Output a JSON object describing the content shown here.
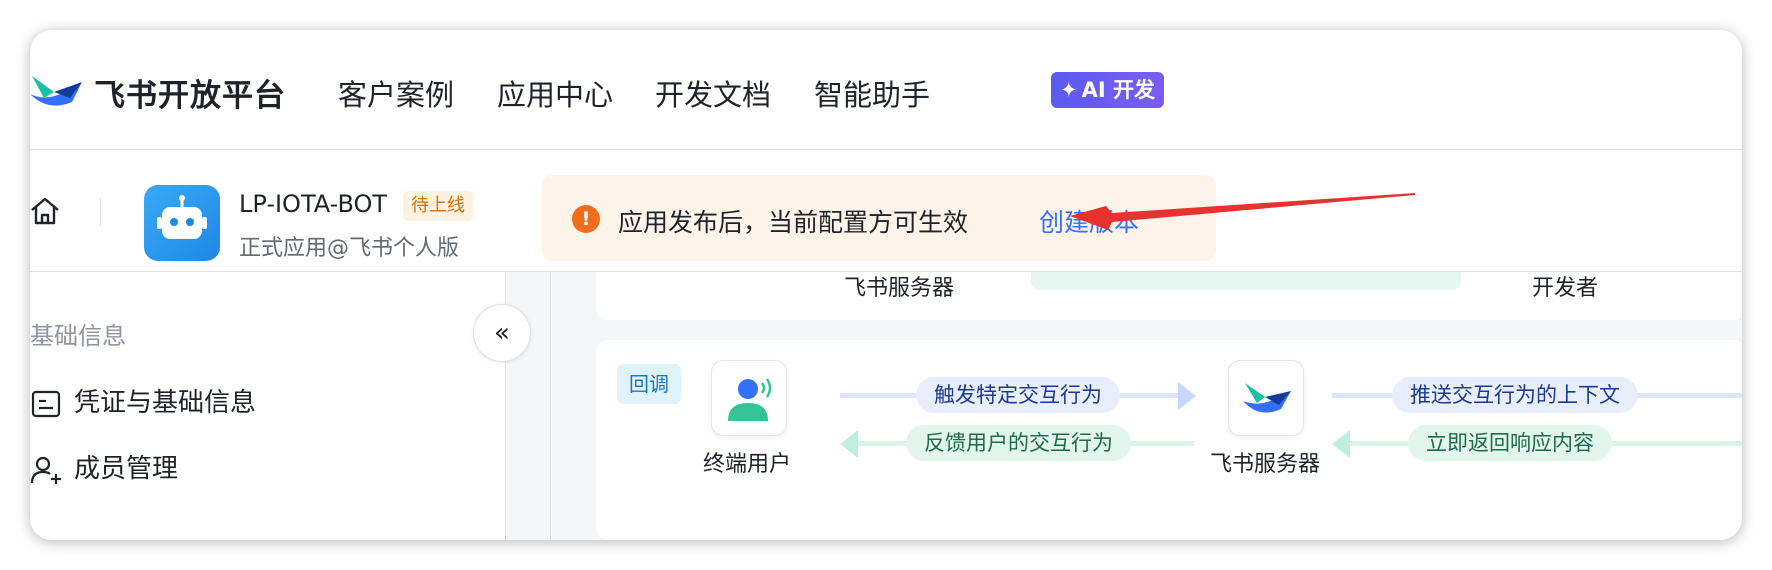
{
  "topnav": {
    "brand": "飞书开放平台",
    "items": [
      "客户案例",
      "应用中心",
      "开发文档",
      "智能助手"
    ],
    "ai_badge": "AI 开发"
  },
  "appbar": {
    "app_name": "LP-IOTA-BOT",
    "status_badge": "待上线",
    "subtitle": "正式应用@飞书个人版",
    "notice_text": "应用发布后，当前配置方可生效",
    "notice_link": "创建版本"
  },
  "sidebar": {
    "group": "基础信息",
    "items": [
      "凭证与基础信息",
      "成员管理"
    ],
    "collapse_label": "«"
  },
  "upper_card": {
    "left_label": "飞书服务器",
    "right_label": "开发者"
  },
  "flow": {
    "tag": "回调",
    "end_user_label": "终端用户",
    "server_label": "飞书服务器",
    "pill_trigger": "触发特定交互行为",
    "pill_feedback": "反馈用户的交互行为",
    "pill_push": "推送交互行为的上下文",
    "pill_return": "立即返回响应内容"
  },
  "colors": {
    "accent": "#3370ff",
    "warning": "#f26c1d",
    "ai_badge": "#6c5ce7",
    "annotation_arrow": "#e8322f"
  }
}
